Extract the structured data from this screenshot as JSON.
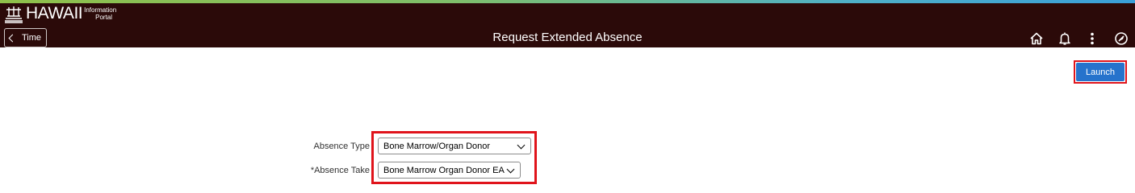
{
  "header": {
    "logo_text": "HAWAII",
    "logo_sub_line1": "Information",
    "logo_sub_line2": "Portal",
    "back_label": "Time",
    "title": "Request Extended Absence"
  },
  "toolbar": {
    "launch_label": "Launch"
  },
  "form": {
    "absence_type_label": "Absence Type",
    "absence_type_value": "Bone Marrow/Organ Donor",
    "absence_take_label": "*Absence Take",
    "absence_take_value": "Bone Marrow Organ Donor EA"
  },
  "colors": {
    "banner": "#2b0a09",
    "launch_button": "#2673cc",
    "highlight": "#e0141b"
  }
}
